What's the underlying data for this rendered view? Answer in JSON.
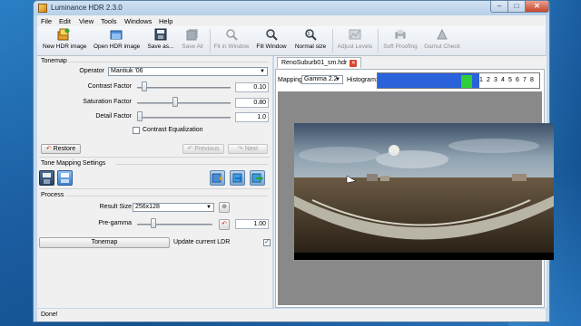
{
  "window": {
    "title": "Luminance HDR 2.3.0",
    "min": "–",
    "max": "□",
    "close": "✕"
  },
  "menu": [
    "File",
    "Edit",
    "View",
    "Tools",
    "Windows",
    "Help"
  ],
  "toolbar": [
    {
      "label": "New HDR image",
      "icon": "new-hdr-icon",
      "enabled": true
    },
    {
      "label": "Open HDR image",
      "icon": "open-hdr-icon",
      "enabled": true
    },
    {
      "label": "Save as...",
      "icon": "save-icon",
      "enabled": true
    },
    {
      "label": "Save All",
      "icon": "save-all-icon",
      "enabled": false
    },
    {
      "label": "Fit in Window",
      "icon": "fit-window-icon",
      "enabled": false
    },
    {
      "label": "Fill Window",
      "icon": "fill-window-icon",
      "enabled": true
    },
    {
      "label": "Normal size",
      "icon": "normal-size-icon",
      "enabled": true
    },
    {
      "label": "Adjust Levels",
      "icon": "adjust-levels-icon",
      "enabled": false
    },
    {
      "label": "Soft Proofing",
      "icon": "soft-proofing-icon",
      "enabled": false
    },
    {
      "label": "Gamut Check",
      "icon": "gamut-check-icon",
      "enabled": false
    }
  ],
  "tonemap": {
    "group_title": "Tonemap",
    "operator_label": "Operator",
    "operator_value": "Mantiuk '06",
    "contrast_label": "Contrast Factor",
    "contrast_value": "0.10",
    "contrast_frac": 0.05,
    "saturation_label": "Saturation Factor",
    "saturation_value": "0.80",
    "saturation_frac": 0.4,
    "detail_label": "Detail Factor",
    "detail_value": "1.0",
    "detail_frac": 0.0,
    "contrast_eq_label": "Contrast Equalization",
    "restore_label": "Restore",
    "previous_label": "Previous",
    "next_label": "Next"
  },
  "settings": {
    "group_title": "Tone Mapping Settings"
  },
  "process": {
    "group_title": "Process",
    "result_size_label": "Result Size",
    "result_size_value": "256x128",
    "pregamma_label": "Pre-gamma",
    "pregamma_value": "1.00",
    "pregamma_frac": 0.2,
    "tonemap_label": "Tonemap",
    "update_ldr_label": "Update current LDR",
    "update_ldr_checked": true
  },
  "viewer": {
    "tab_label": "RenoSuburb01_sm.hdr",
    "mapping_label": "Mapping:",
    "mapping_value": "Gamma 2.2",
    "histogram_label": "Histogram:",
    "hist_ticks": [
      "1",
      "2",
      "3",
      "4",
      "5",
      "6",
      "7",
      "8"
    ]
  },
  "status": "Done!"
}
